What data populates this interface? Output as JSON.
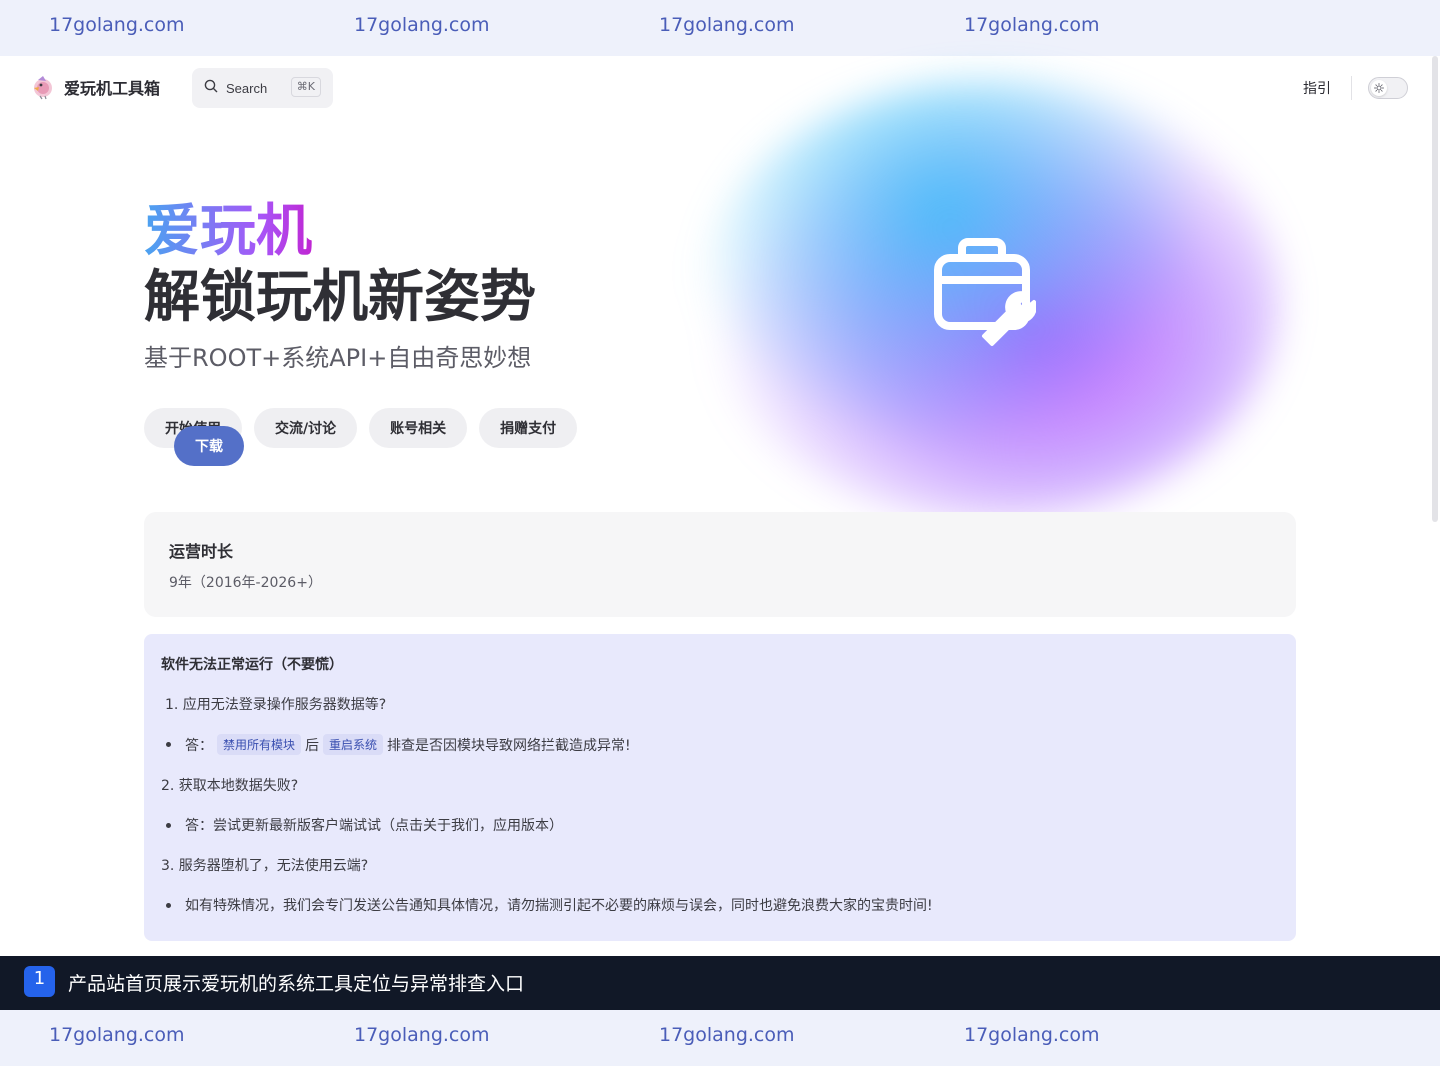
{
  "watermark": {
    "text": [
      "17golang.com",
      "17golang.com",
      "17golang.com",
      "17golang.com"
    ]
  },
  "nav": {
    "brand_title": "爱玩机工具箱",
    "search_label": "Search",
    "search_shortcut": "⌘K",
    "links": [
      "指引"
    ],
    "theme_toggle_icon": "sun-icon"
  },
  "hero": {
    "name": "爱玩机",
    "text": "解锁玩机新姿势",
    "tagline": "基于ROOT+系统API+自由奇思妙想",
    "actions": [
      "下载",
      "开始使用",
      "交流/讨论",
      "账号相关",
      "捐赠支付"
    ],
    "icon": "toolbox-wrench-icon",
    "gradient_colors": [
      "#38bdf8",
      "#a855f7"
    ]
  },
  "feature": {
    "title": "运营时长",
    "detail": "9年（2016年-2026+）"
  },
  "tip": {
    "title": "软件无法正常运行（不要慌）",
    "q1": "1. 应用无法登录操作服务器数据等?",
    "a1_prefix": "答：",
    "a1_code1": "禁用所有模块",
    "a1_mid": "后",
    "a1_code2": "重启系统",
    "a1_suffix": "排查是否因模块导致网络拦截造成异常!",
    "q2": "2. 获取本地数据失败?",
    "a2": "答：尝试更新最新版客户端试试（点击关于我们，应用版本）",
    "q3": "3. 服务器堕机了，无法使用云端?",
    "a3": "如有特殊情况，我们会专门发送公告通知具体情况，请勿揣测引起不必要的麻烦与误会，同时也避免浪费大家的宝贵时间!"
  },
  "caption": {
    "number": "1",
    "text": "产品站首页展示爱玩机的系统工具定位与异常排查入口"
  },
  "colors": {
    "brand_button": "#5470c8",
    "tip_background": "#e8e9fc",
    "watermark": "#4a5db8",
    "caption_background": "#111827"
  }
}
